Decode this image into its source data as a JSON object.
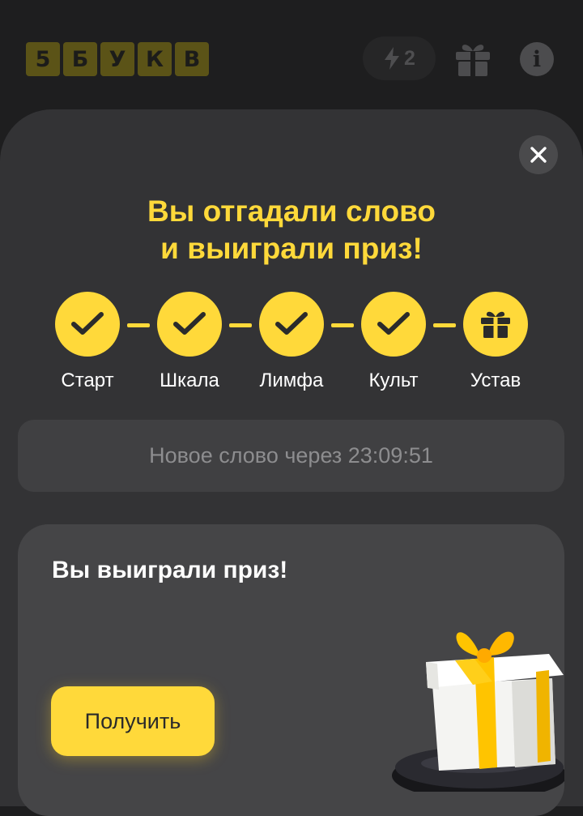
{
  "header": {
    "logo_letters": [
      "5",
      "Б",
      "У",
      "К",
      "В"
    ],
    "energy_count": "2",
    "info_label": "i",
    "icons": {
      "energy": "lightning-icon",
      "gift": "gift-icon",
      "info": "info-icon"
    }
  },
  "modal": {
    "close_icon": "close-icon",
    "headline_line1": "Вы отгадали слово",
    "headline_line2": "и выиграли приз!",
    "steps": [
      {
        "label": "Старт",
        "status": "done",
        "icon": "check-icon"
      },
      {
        "label": "Шкала",
        "status": "done",
        "icon": "check-icon"
      },
      {
        "label": "Лимфа",
        "status": "done",
        "icon": "check-icon"
      },
      {
        "label": "Культ",
        "status": "done",
        "icon": "check-icon"
      },
      {
        "label": "Устав",
        "status": "prize",
        "icon": "gift-icon"
      }
    ],
    "countdown_text": "Новое слово через 23:09:51"
  },
  "prize_card": {
    "title": "Вы выиграли приз!",
    "button_label": "Получить",
    "illustration": "gift-box-illustration"
  },
  "colors": {
    "accent": "#ffd93a",
    "background": "#1e1e1f",
    "sheet": "#333335",
    "card": "#454547",
    "muted_text": "#8d8d8f"
  }
}
